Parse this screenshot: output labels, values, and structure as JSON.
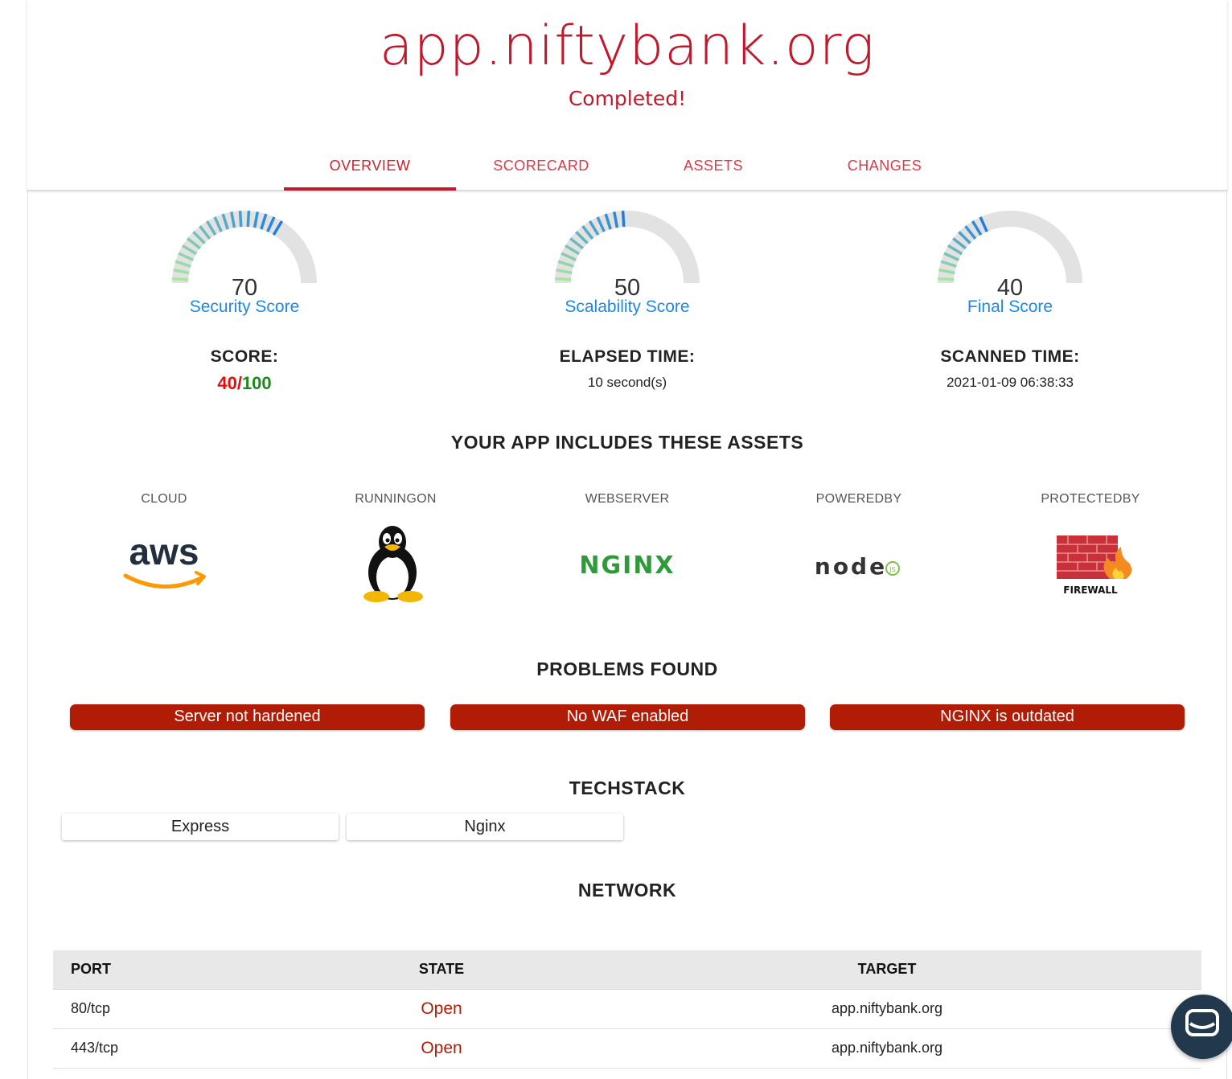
{
  "header": {
    "site": "app.niftybank.org",
    "status": "Completed!"
  },
  "tabs": [
    {
      "label": "OVERVIEW",
      "active": true
    },
    {
      "label": "SCORECARD",
      "active": false
    },
    {
      "label": "ASSETS",
      "active": false
    },
    {
      "label": "CHANGES",
      "active": false
    }
  ],
  "gauges": [
    {
      "value": "70",
      "label": "Security Score",
      "level": 0.7
    },
    {
      "value": "50",
      "label": "Scalability Score",
      "level": 0.5
    },
    {
      "value": "40",
      "label": "Final Score",
      "level": 0.4
    }
  ],
  "stats": {
    "score": {
      "title": "SCORE:",
      "value": "40/",
      "max": "100"
    },
    "elapsed": {
      "title": "ELAPSED TIME:",
      "value": "10 second(s)"
    },
    "scanned": {
      "title": "SCANNED TIME:",
      "value": "2021-01-09 06:38:33"
    }
  },
  "assets_section": {
    "title": "YOUR APP INCLUDES THESE ASSETS",
    "items": [
      {
        "label": "CLOUD",
        "logo_text": "aws",
        "icon": "aws-logo"
      },
      {
        "label": "RUNNINGON",
        "icon": "linux-tux-logo"
      },
      {
        "label": "WEBSERVER",
        "logo_text": "NGINX",
        "icon": "nginx-logo"
      },
      {
        "label": "POWEREDBY",
        "logo_text": "node",
        "logo_sub": "JS",
        "icon": "nodejs-logo"
      },
      {
        "label": "PROTECTEDBY",
        "logo_text": "FIREWALL",
        "icon": "firewall-logo"
      }
    ]
  },
  "problems": {
    "title": "PROBLEMS FOUND",
    "items": [
      "Server not hardened",
      "No WAF enabled",
      "NGINX is outdated"
    ]
  },
  "techstack": {
    "title": "TECHSTACK",
    "items": [
      "Express",
      "Nginx"
    ]
  },
  "network": {
    "title": "NETWORK",
    "columns": [
      "PORT",
      "STATE",
      "TARGET"
    ],
    "rows": [
      {
        "port": "80/tcp",
        "state": "Open",
        "target": "app.niftybank.org"
      },
      {
        "port": "443/tcp",
        "state": "Open",
        "target": "app.niftybank.org"
      }
    ]
  },
  "colors": {
    "brand": "#c0182c",
    "problem_bg": "#b01c06",
    "gauge_label": "#1e88e5",
    "score_red": "#e01010",
    "score_green": "#1a8a1a",
    "chat_bg": "#22384d"
  },
  "chat": {
    "icon": "chat-bubble-icon"
  }
}
